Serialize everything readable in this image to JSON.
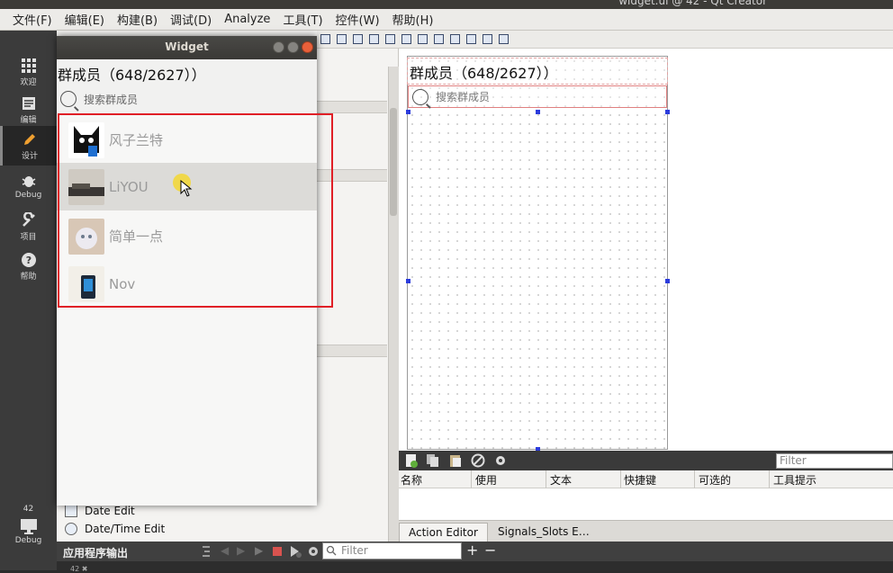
{
  "titlebar": {
    "text": "widget.ui @ 42 - Qt Creator"
  },
  "menubar": {
    "items": [
      "文件(F)",
      "编辑(E)",
      "构建(B)",
      "调试(D)",
      "Analyze",
      "工具(T)",
      "控件(W)",
      "帮助(H)"
    ]
  },
  "modes": [
    {
      "label": "欢迎",
      "icon": "grid-icon"
    },
    {
      "label": "编辑",
      "icon": "document-icon"
    },
    {
      "label": "设计",
      "icon": "pencil-icon"
    },
    {
      "label": "Debug",
      "icon": "bug-icon"
    },
    {
      "label": "项目",
      "icon": "wrench-icon"
    },
    {
      "label": "帮助",
      "icon": "help-icon"
    }
  ],
  "kit": {
    "label": "42",
    "mode": "Debug"
  },
  "widget_box": {
    "items": [
      "Date Edit",
      "Date/Time Edit"
    ]
  },
  "widget_window": {
    "title": "Widget",
    "header": "群成员（648/2627））",
    "search_placeholder": "搜索群成员",
    "members": [
      {
        "name": "风子兰特"
      },
      {
        "name": "LiYOU"
      },
      {
        "name": "简单一点"
      },
      {
        "name": "Nov"
      }
    ]
  },
  "form_preview": {
    "header": "群成员（648/2627））",
    "search_placeholder": "搜索群成员"
  },
  "action_editor": {
    "filter_placeholder": "Filter",
    "columns": [
      "名称",
      "使用",
      "文本",
      "快捷键",
      "可选的",
      "工具提示"
    ],
    "tabs": [
      "Action Editor",
      "Signals_Slots E…"
    ]
  },
  "output": {
    "label": "应用程序输出",
    "filter_placeholder": "Filter",
    "bottom_text": "42 ✖"
  },
  "colors": {
    "highlight": "#e01f26",
    "cursor": "#f5d728"
  }
}
